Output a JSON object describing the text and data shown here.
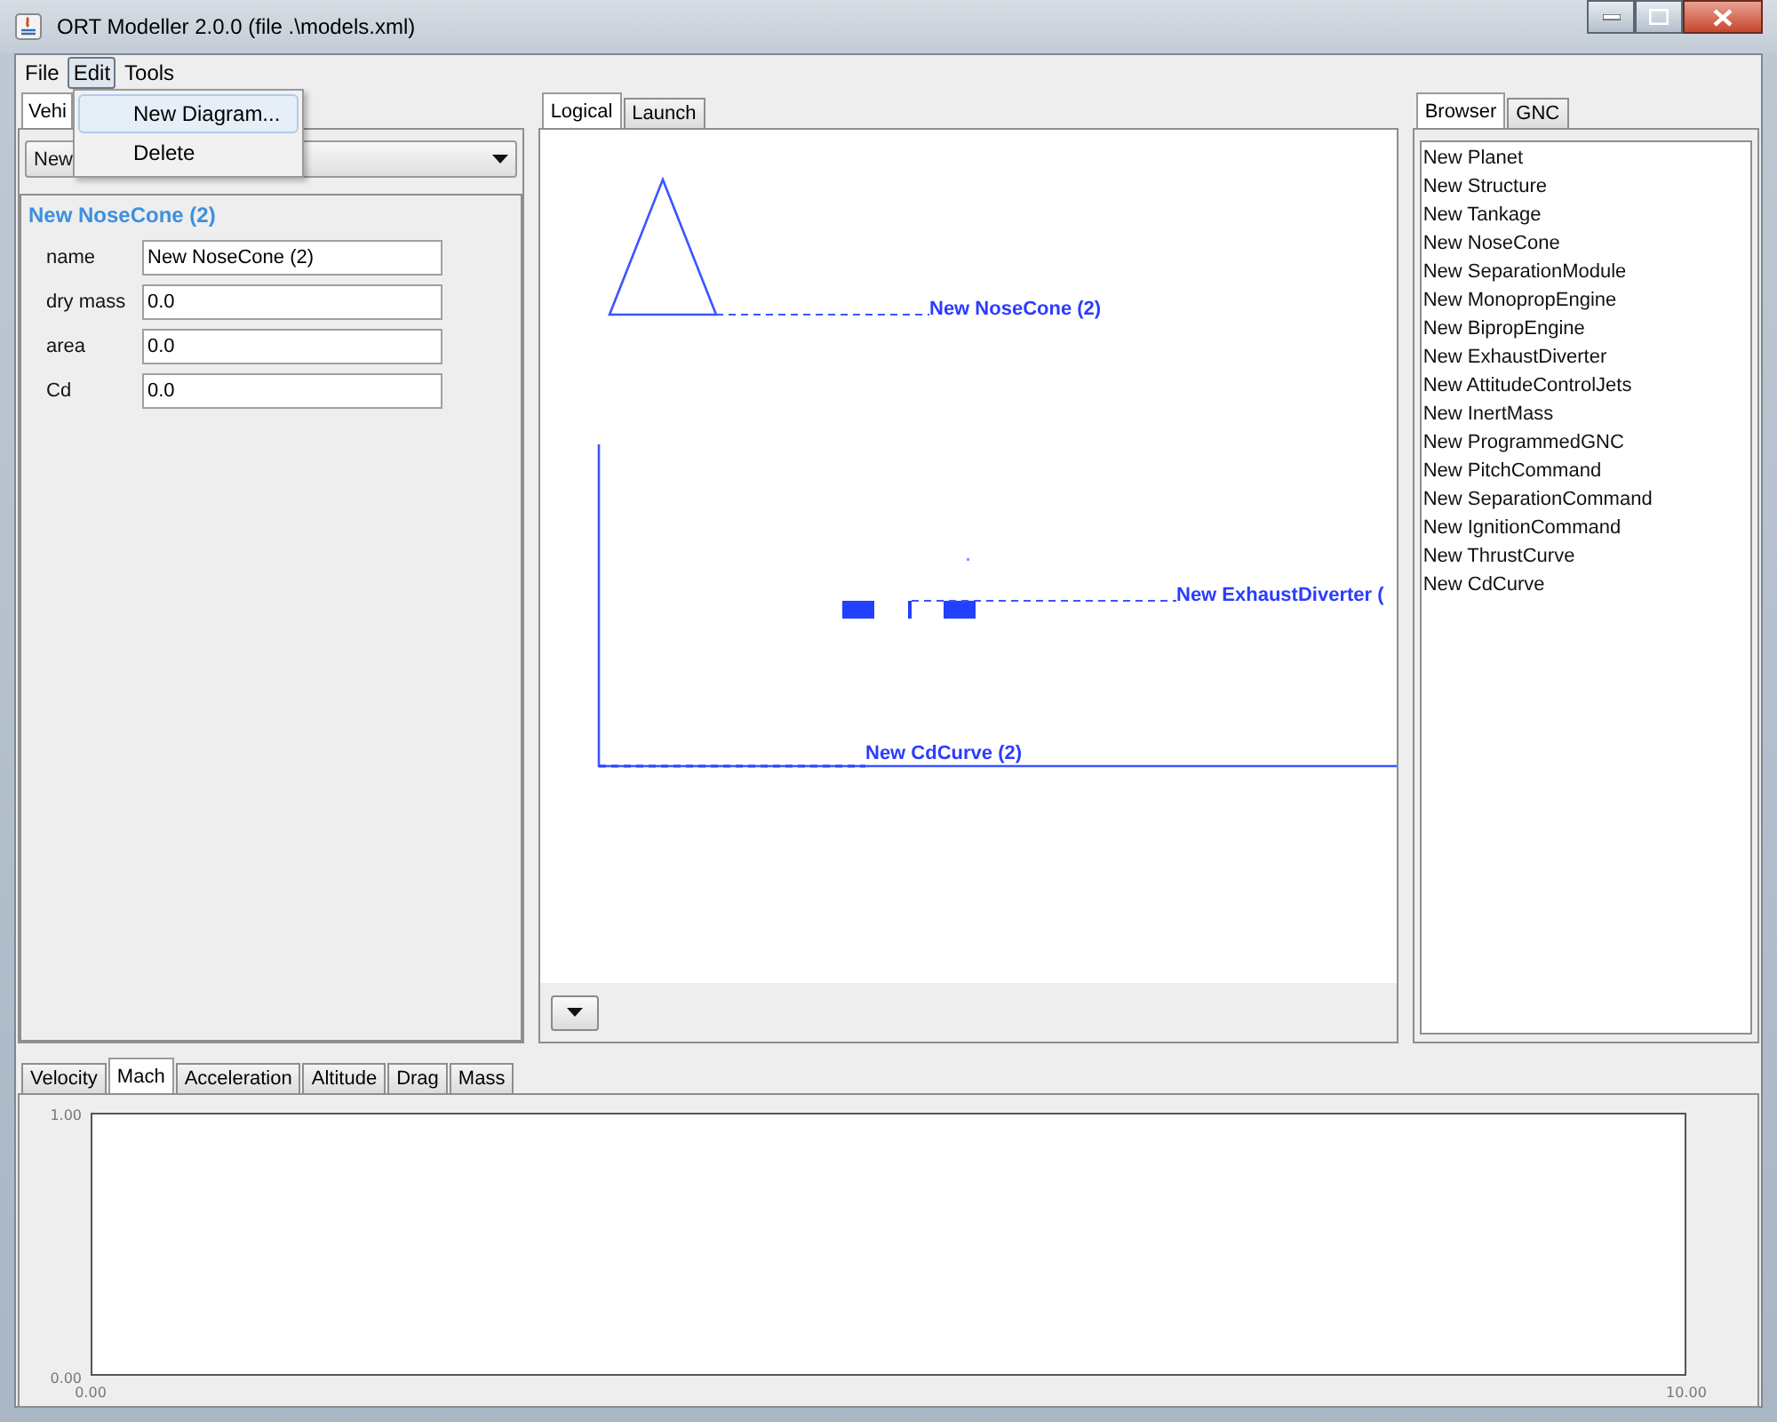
{
  "window": {
    "title": "ORT Modeller 2.0.0 (file .\\models.xml)"
  },
  "menu_bar": [
    {
      "label": "File",
      "selected": false
    },
    {
      "label": "Edit",
      "selected": true
    },
    {
      "label": "Tools",
      "selected": false
    }
  ],
  "edit_menu": [
    {
      "label": "New Diagram...",
      "selected": true
    },
    {
      "label": "Delete",
      "selected": false
    }
  ],
  "left_panel": {
    "tabs": [
      {
        "label": "Vehi",
        "selected": true
      }
    ],
    "dropdown": {
      "value": "New"
    },
    "heading": "New NoseCone (2)",
    "fields": [
      {
        "label": "name",
        "value": "New NoseCone (2)"
      },
      {
        "label": "dry mass",
        "value": "0.0"
      },
      {
        "label": "area",
        "value": "0.0"
      },
      {
        "label": "Cd",
        "value": "0.0"
      }
    ]
  },
  "diagram": {
    "tabs": [
      {
        "label": "Logical",
        "selected": true
      },
      {
        "label": "Launch",
        "selected": false
      }
    ],
    "labels": [
      {
        "kind": "nosecone",
        "text": "New NoseCone (2)"
      },
      {
        "kind": "diverter",
        "text": "New ExhaustDiverter ("
      },
      {
        "kind": "curve",
        "text": "New CdCurve (2)"
      }
    ]
  },
  "right_panel": {
    "tabs": [
      {
        "label": "Browser",
        "selected": true
      },
      {
        "label": "GNC",
        "selected": false
      }
    ],
    "items": [
      "New Planet",
      "New Structure",
      "New Tankage",
      "New NoseCone",
      "New SeparationModule",
      "New MonopropEngine",
      "New BipropEngine",
      "New ExhaustDiverter",
      "New AttitudeControlJets",
      "New InertMass",
      "New ProgrammedGNC",
      "New PitchCommand",
      "New SeparationCommand",
      "New IgnitionCommand",
      "New ThrustCurve",
      "New CdCurve"
    ]
  },
  "plot": {
    "tabs": [
      {
        "label": "Velocity",
        "selected": false
      },
      {
        "label": "Mach",
        "selected": true
      },
      {
        "label": "Acceleration",
        "selected": false
      },
      {
        "label": "Altitude",
        "selected": false
      },
      {
        "label": "Drag",
        "selected": false
      },
      {
        "label": "Mass",
        "selected": false
      }
    ],
    "chart_data": {
      "type": "line",
      "xlim": [
        0,
        10
      ],
      "ylim": [
        0,
        1
      ],
      "xticks": [
        {
          "value": 0,
          "label": "0.00"
        },
        {
          "value": 10,
          "label": "10.00"
        }
      ],
      "yticks": [
        {
          "value": 0,
          "label": "0.00"
        },
        {
          "value": 1,
          "label": "1.00"
        }
      ]
    }
  }
}
